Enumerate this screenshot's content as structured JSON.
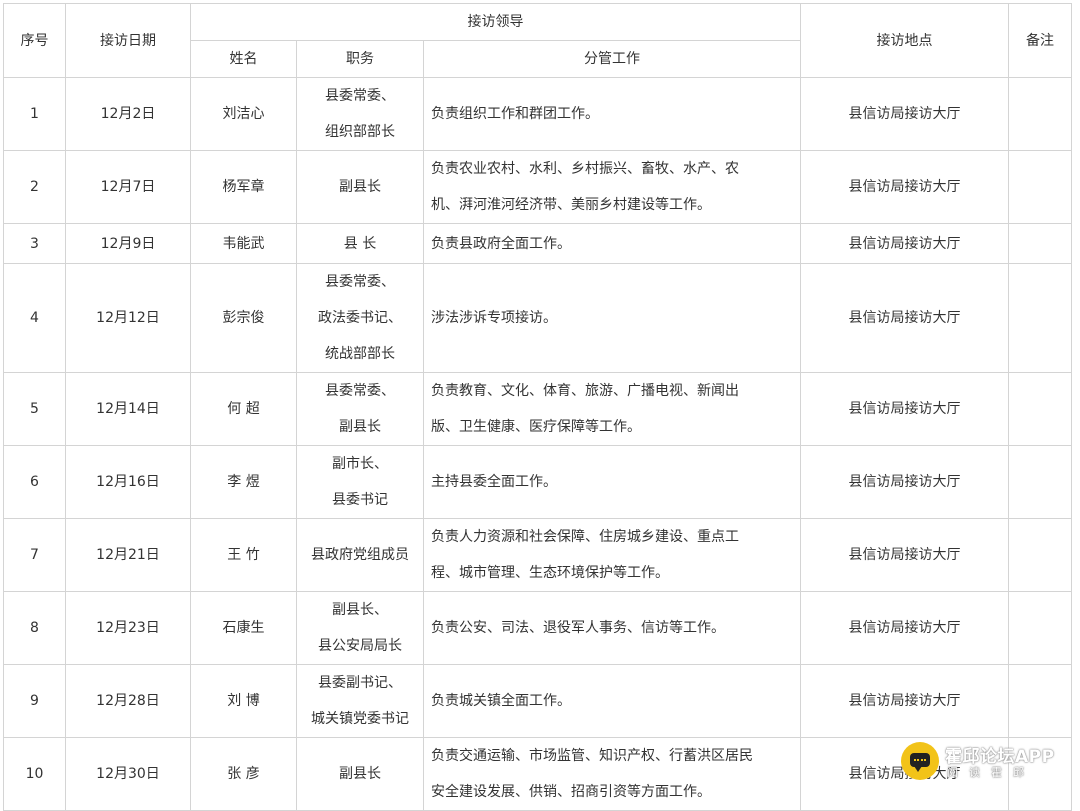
{
  "header": {
    "seq": "序号",
    "date": "接访日期",
    "leader_group": "接访领导",
    "name": "姓名",
    "position": "职务",
    "duty": "分管工作",
    "place": "接访地点",
    "note": "备注"
  },
  "rows": [
    {
      "seq": "1",
      "date": "12月2日",
      "name": "刘洁心",
      "position": [
        "县委常委、",
        "组织部部长"
      ],
      "duty": [
        "负责组织工作和群团工作。"
      ],
      "place": "县信访局接访大厅",
      "note": ""
    },
    {
      "seq": "2",
      "date": "12月7日",
      "name": "杨军章",
      "position": [
        "副县长"
      ],
      "duty": [
        "负责农业农村、水利、乡村振兴、畜牧、水产、农",
        "机、湃河淮河经济带、美丽乡村建设等工作。"
      ],
      "place": "县信访局接访大厅",
      "note": ""
    },
    {
      "seq": "3",
      "date": "12月9日",
      "name": "韦能武",
      "position": [
        "县 长"
      ],
      "duty": [
        "负责县政府全面工作。"
      ],
      "place": "县信访局接访大厅",
      "note": ""
    },
    {
      "seq": "4",
      "date": "12月12日",
      "name": "彭宗俊",
      "position": [
        "县委常委、",
        "政法委书记、",
        "统战部部长"
      ],
      "duty": [
        "涉法涉诉专项接访。"
      ],
      "place": "县信访局接访大厅",
      "note": ""
    },
    {
      "seq": "5",
      "date": "12月14日",
      "name": "何 超",
      "position": [
        "县委常委、",
        "副县长"
      ],
      "duty": [
        "负责教育、文化、体育、旅游、广播电视、新闻出",
        "版、卫生健康、医疗保障等工作。"
      ],
      "place": "县信访局接访大厅",
      "note": ""
    },
    {
      "seq": "6",
      "date": "12月16日",
      "name": "李 煜",
      "position": [
        "副市长、",
        "县委书记"
      ],
      "duty": [
        "主持县委全面工作。"
      ],
      "place": "县信访局接访大厅",
      "note": ""
    },
    {
      "seq": "7",
      "date": "12月21日",
      "name": "王 竹",
      "position": [
        "县政府党组成员"
      ],
      "duty": [
        "负责人力资源和社会保障、住房城乡建设、重点工",
        "程、城市管理、生态环境保护等工作。"
      ],
      "place": "县信访局接访大厅",
      "note": ""
    },
    {
      "seq": "8",
      "date": "12月23日",
      "name": "石康生",
      "position": [
        "副县长、",
        "县公安局局长"
      ],
      "duty": [
        "负责公安、司法、退役军人事务、信访等工作。"
      ],
      "place": "县信访局接访大厅",
      "note": ""
    },
    {
      "seq": "9",
      "date": "12月28日",
      "name": "刘 博",
      "position": [
        "县委副书记、",
        "城关镇党委书记"
      ],
      "duty": [
        "负责城关镇全面工作。"
      ],
      "place": "县信访局接访大厅",
      "note": ""
    },
    {
      "seq": "10",
      "date": "12月30日",
      "name": "张 彦",
      "position": [
        "副县长"
      ],
      "duty": [
        "负责交通运输、市场监管、知识产权、行蓄洪区居民",
        "安全建设发展、供销、招商引资等方面工作。"
      ],
      "place": "县信访局接访大厅",
      "note": ""
    }
  ],
  "watermark": {
    "title": "霍邱论坛APP",
    "subtitle": "阅读霍邱",
    "icon": "chat-bubble-icon",
    "color": "#f2c318"
  }
}
